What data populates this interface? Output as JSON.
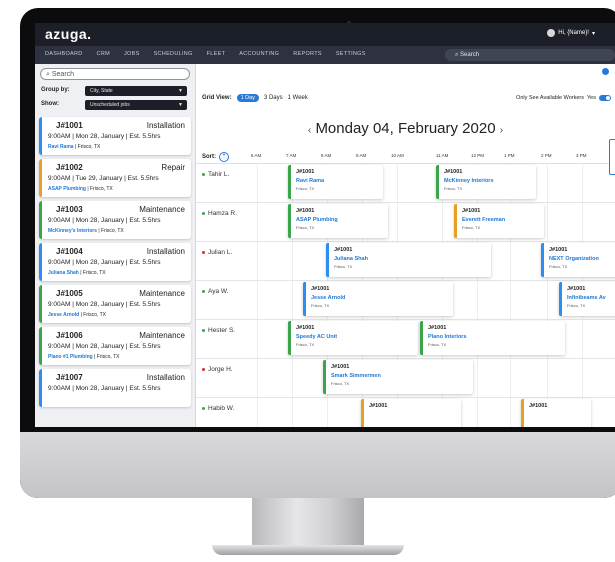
{
  "app": {
    "logo": "azuga."
  },
  "user": {
    "label": "Hi, {Name}!",
    "caret": "▾"
  },
  "nav": {
    "items": [
      "DASHBOARD",
      "CRM",
      "JOBS",
      "SCHEDULING",
      "FLEET",
      "ACCOUNTING",
      "REPORTS",
      "SETTINGS"
    ],
    "search_placeholder": "Search"
  },
  "left_panel": {
    "search_placeholder": "Search",
    "group_by_label": "Group by:",
    "group_by_value": "City, State",
    "show_label": "Show:",
    "show_value": "Unscheduled jobs",
    "jobs": [
      {
        "id": "J#1001",
        "type": "Installation",
        "time": "9:00AM | Mon 28, January | Est. 5.5hrs",
        "customer": "Ravi Rama",
        "location": " | Frisco, TX",
        "color": "#2e8ef0"
      },
      {
        "id": "J#1002",
        "type": "Repair",
        "time": "9:00AM | Tue 29, January | Est. 5.5hrs",
        "customer": "ASAP Plumbing",
        "location": " | Frisco, TX",
        "color": "#e8a024"
      },
      {
        "id": "J#1003",
        "type": "Maintenance",
        "time": "9:00AM | Mon 28, January | Est. 5.5hrs",
        "customer": "McKinney's Interiors",
        "location": " | Frisco, TX",
        "color": "#3aa54a"
      },
      {
        "id": "J#1004",
        "type": "Installation",
        "time": "9:00AM | Mon 28, January | Est. 5.5hrs",
        "customer": "Juliana Shah",
        "location": " | Frisco, TX",
        "color": "#2e8ef0"
      },
      {
        "id": "J#1005",
        "type": "Maintenance",
        "time": "9:00AM | Mon 28, January | Est. 5.5hrs",
        "customer": "Jesse Arnold",
        "location": " | Frisco, TX",
        "color": "#3aa54a"
      },
      {
        "id": "J#1006",
        "type": "Maintenance",
        "time": "9:00AM | Mon 28, January | Est. 5.5hrs",
        "customer": "Plano #1 Plumbing",
        "location": " | Frisco, TX",
        "color": "#3aa54a"
      },
      {
        "id": "J#1007",
        "type": "Installation",
        "time": "9:00AM | Mon 28, January | Est. 5.5hrs",
        "customer": "",
        "location": "",
        "color": "#2e8ef0"
      }
    ]
  },
  "grid": {
    "grid_view_label": "Grid View:",
    "views": [
      "1 Day",
      "3 Days",
      "1 Week"
    ],
    "only_see_label": "Only See Available Workers",
    "toggle_label": "Yes",
    "date_title": "Monday 04, February 2020",
    "prev": "‹",
    "next": "›",
    "sort_label": "Sort:",
    "hours": [
      "6 AM",
      "7 AM",
      "8 AM",
      "9 AM",
      "10 AM",
      "11 AM",
      "12 PM",
      "1 PM",
      "2 PM",
      "3 PM"
    ]
  },
  "workers": [
    {
      "name": "Tahir L.",
      "dot": "#3aa54a"
    },
    {
      "name": "Hamza R.",
      "dot": "#3aa54a"
    },
    {
      "name": "Julian L.",
      "dot": "#d93030"
    },
    {
      "name": "Aya W.",
      "dot": "#3aa54a"
    },
    {
      "name": "Hester S.",
      "dot": "#3aa54a"
    },
    {
      "name": "Jorge H.",
      "dot": "#d93030"
    },
    {
      "name": "Habib W.",
      "dot": "#3aa54a"
    }
  ],
  "cards": [
    {
      "row": 0,
      "id": "J#1001",
      "name": "Ravi Rama",
      "loc": "Frisco, TX",
      "color": "#3aa54a"
    },
    {
      "row": 0,
      "id": "J#1001",
      "name": "McKinney Interiors",
      "loc": "Frisco, TX",
      "color": "#3aa54a"
    },
    {
      "row": 1,
      "id": "J#1001",
      "name": "ASAP Plumbing",
      "loc": "Frisco, TX",
      "color": "#3aa54a"
    },
    {
      "row": 1,
      "id": "J#1001",
      "name": "Everett Freeman",
      "loc": "Frisco, TX",
      "color": "#e8a024"
    },
    {
      "row": 2,
      "id": "J#1001",
      "name": "Juliana Shah",
      "loc": "Frisco, TX",
      "color": "#2e8ef0"
    },
    {
      "row": 2,
      "id": "J#1001",
      "name": "NEXT Organization",
      "loc": "Frisco, TX",
      "color": "#2e8ef0"
    },
    {
      "row": 3,
      "id": "J#1001",
      "name": "Jesse Arnold",
      "loc": "Frisco, TX",
      "color": "#2e8ef0"
    },
    {
      "row": 3,
      "id": "J#1001",
      "name": "Infinibeams Av",
      "loc": "Frisco, TX",
      "color": "#2e8ef0"
    },
    {
      "row": 4,
      "id": "J#1001",
      "name": "Speedy AC Unit",
      "loc": "Frisco, TX",
      "color": "#3aa54a"
    },
    {
      "row": 4,
      "id": "J#1001",
      "name": "Plano Interiors",
      "loc": "Frisco, TX",
      "color": "#3aa54a"
    },
    {
      "row": 5,
      "id": "J#1001",
      "name": "Smark Simmermen",
      "loc": "Frisco, TX",
      "color": "#3aa54a"
    },
    {
      "row": 6,
      "id": "J#1001",
      "name": "",
      "loc": "",
      "color": "#e8a024"
    },
    {
      "row": 6,
      "id": "J#1001",
      "name": "",
      "loc": "",
      "color": "#e8a024"
    }
  ]
}
